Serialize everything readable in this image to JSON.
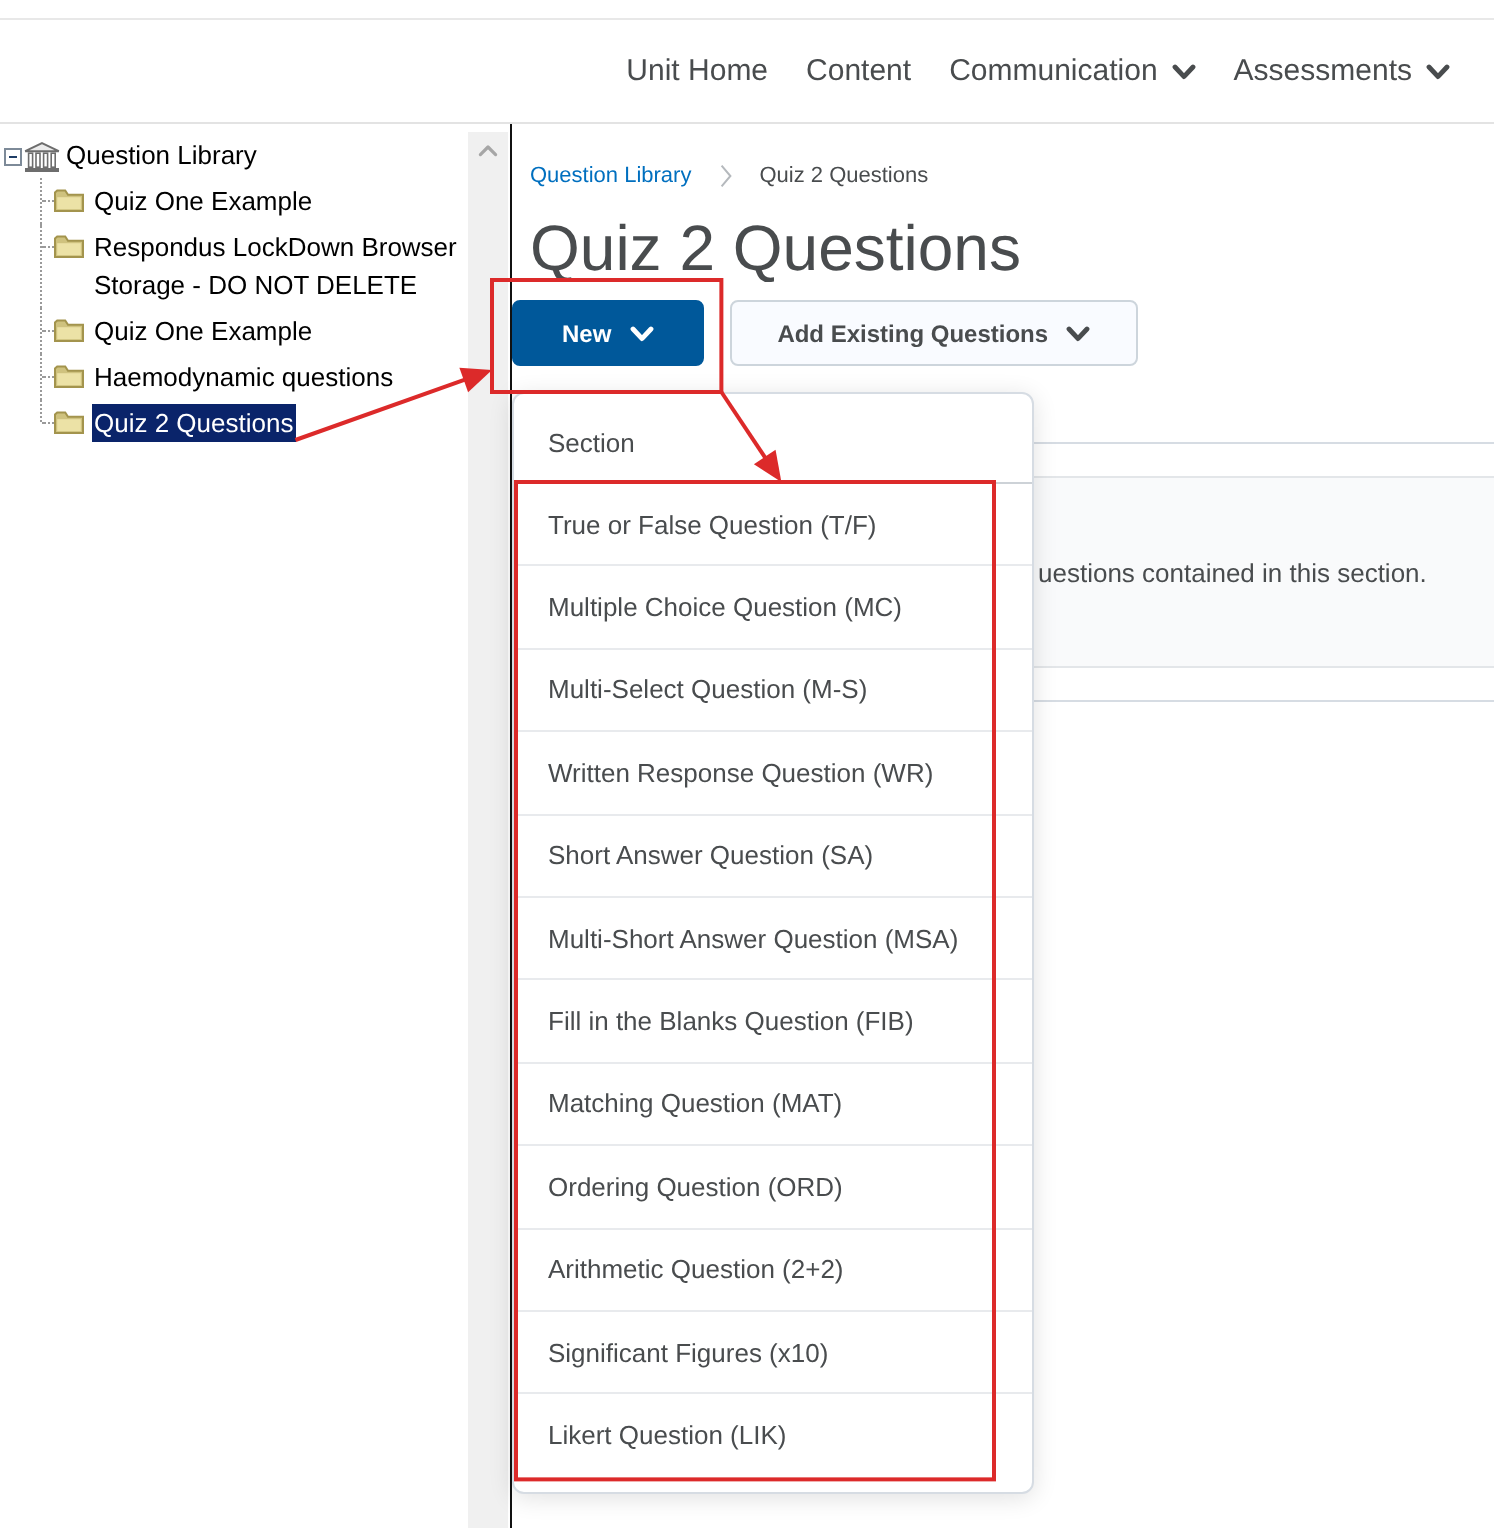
{
  "nav": {
    "items": [
      {
        "label": "Unit Home",
        "has_menu": false
      },
      {
        "label": "Content",
        "has_menu": false
      },
      {
        "label": "Communication",
        "has_menu": true
      },
      {
        "label": "Assessments",
        "has_menu": true
      }
    ]
  },
  "tree": {
    "label": "Question Library",
    "selected": false,
    "expanded": true,
    "children": [
      {
        "label": "Quiz One Example",
        "selected": false
      },
      {
        "label": "Respondus LockDown Browser Storage - DO NOT DELETE",
        "selected": false
      },
      {
        "label": "Quiz One Example",
        "selected": false
      },
      {
        "label": "Haemodynamic questions",
        "selected": false
      },
      {
        "label": "Quiz 2 Questions",
        "selected": true
      }
    ]
  },
  "breadcrumb": [
    {
      "label": "Question Library",
      "kind": "link"
    },
    {
      "label": "Quiz 2 Questions",
      "kind": "current"
    }
  ],
  "page_title": "Quiz 2 Questions",
  "toolbar": [
    {
      "label": "New",
      "kind": "primary",
      "expanded": true,
      "menu": [
        {
          "label": "Section",
          "kind": "section"
        },
        {
          "label": "True or False Question (T/F)",
          "kind": "question"
        },
        {
          "label": "Multiple Choice Question (MC)",
          "kind": "question"
        },
        {
          "label": "Multi-Select Question (M-S)",
          "kind": "question"
        },
        {
          "label": "Written Response Question (WR)",
          "kind": "question"
        },
        {
          "label": "Short Answer Question (SA)",
          "kind": "question"
        },
        {
          "label": "Multi-Short Answer Question (MSA)",
          "kind": "question"
        },
        {
          "label": "Fill in the Blanks Question (FIB)",
          "kind": "question"
        },
        {
          "label": "Matching Question (MAT)",
          "kind": "question"
        },
        {
          "label": "Ordering Question (ORD)",
          "kind": "question"
        },
        {
          "label": "Arithmetic Question (2+2)",
          "kind": "question"
        },
        {
          "label": "Significant Figures (x10)",
          "kind": "question"
        },
        {
          "label": "Likert Question (LIK)",
          "kind": "question"
        }
      ]
    },
    {
      "label": "Add Existing Questions",
      "kind": "secondary",
      "expanded": false
    }
  ],
  "section_panel": {
    "description": "uestions contained in this section."
  }
}
